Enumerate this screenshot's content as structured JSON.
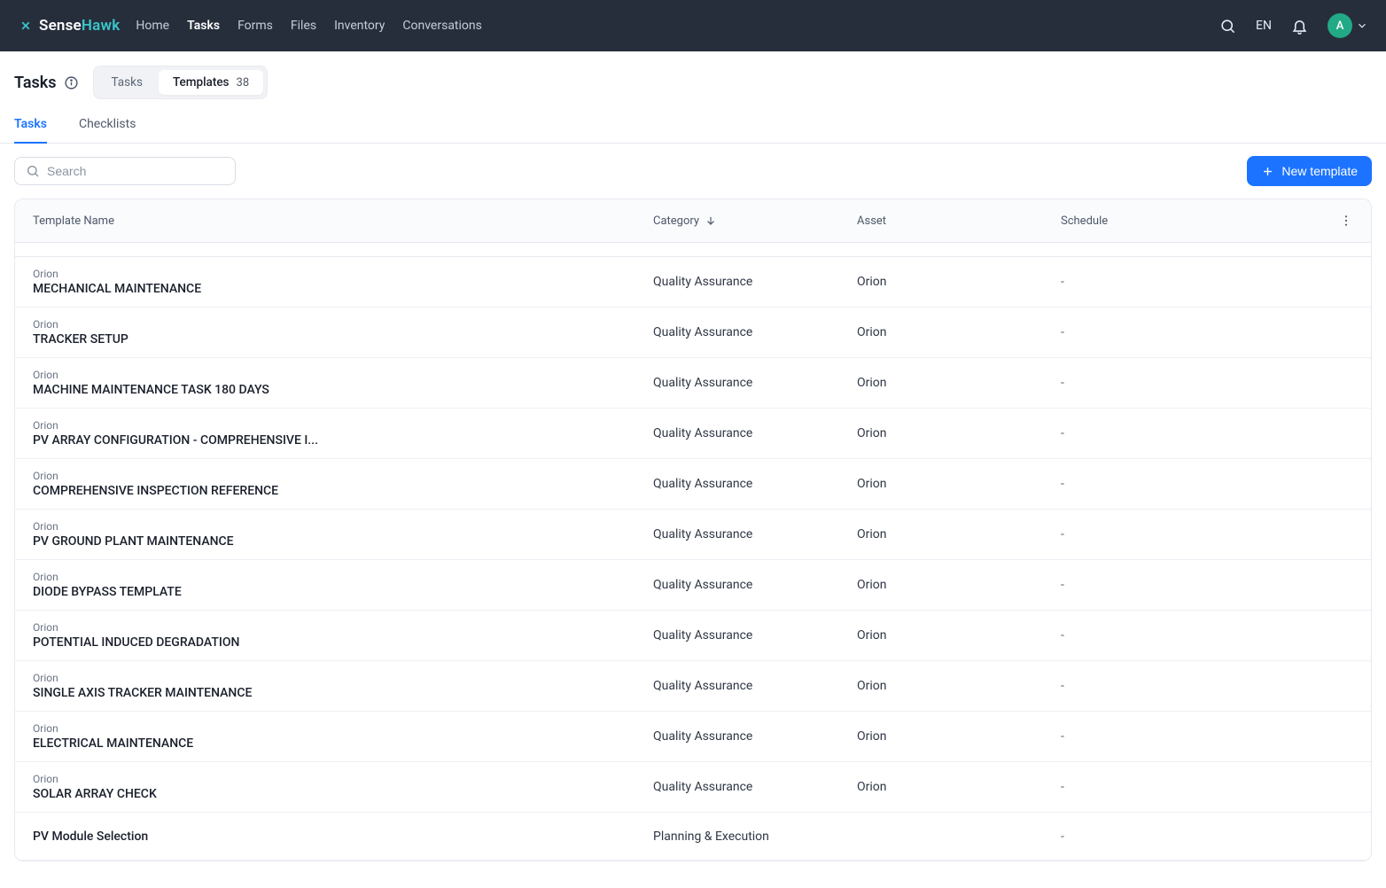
{
  "header": {
    "logo_sense": "Sense",
    "logo_hawk": "Hawk",
    "nav": [
      "Home",
      "Tasks",
      "Forms",
      "Files",
      "Inventory",
      "Conversations"
    ],
    "active_nav": "Tasks",
    "lang": "EN",
    "avatar_initial": "A"
  },
  "page": {
    "title": "Tasks",
    "segments": {
      "tasks": "Tasks",
      "templates_label": "Templates",
      "templates_count": "38"
    },
    "subtabs": {
      "tasks": "Tasks",
      "checklists": "Checklists"
    }
  },
  "toolbar": {
    "search_placeholder": "Search",
    "new_template_label": "New template"
  },
  "table": {
    "headers": {
      "name": "Template Name",
      "category": "Category",
      "asset": "Asset",
      "schedule": "Schedule"
    },
    "rows": [
      {
        "group": "Orion",
        "name": "MECHANICAL MAINTENANCE",
        "category": "Quality Assurance",
        "asset": "Orion",
        "schedule": "-"
      },
      {
        "group": "Orion",
        "name": "TRACKER SETUP",
        "category": "Quality Assurance",
        "asset": "Orion",
        "schedule": "-"
      },
      {
        "group": "Orion",
        "name": "MACHINE MAINTENANCE TASK 180 DAYS",
        "category": "Quality Assurance",
        "asset": "Orion",
        "schedule": "-"
      },
      {
        "group": "Orion",
        "name": "PV ARRAY CONFIGURATION - COMPREHENSIVE I...",
        "category": "Quality Assurance",
        "asset": "Orion",
        "schedule": "-"
      },
      {
        "group": "Orion",
        "name": "COMPREHENSIVE INSPECTION REFERENCE",
        "category": "Quality Assurance",
        "asset": "Orion",
        "schedule": "-"
      },
      {
        "group": "Orion",
        "name": "PV GROUND PLANT MAINTENANCE",
        "category": "Quality Assurance",
        "asset": "Orion",
        "schedule": "-"
      },
      {
        "group": "Orion",
        "name": "DIODE BYPASS TEMPLATE",
        "category": "Quality Assurance",
        "asset": "Orion",
        "schedule": "-"
      },
      {
        "group": "Orion",
        "name": "POTENTIAL INDUCED DEGRADATION",
        "category": "Quality Assurance",
        "asset": "Orion",
        "schedule": "-"
      },
      {
        "group": "Orion",
        "name": "SINGLE AXIS TRACKER MAINTENANCE",
        "category": "Quality Assurance",
        "asset": "Orion",
        "schedule": "-"
      },
      {
        "group": "Orion",
        "name": "ELECTRICAL MAINTENANCE",
        "category": "Quality Assurance",
        "asset": "Orion",
        "schedule": "-"
      },
      {
        "group": "Orion",
        "name": "SOLAR ARRAY CHECK",
        "category": "Quality Assurance",
        "asset": "Orion",
        "schedule": "-"
      },
      {
        "group": "",
        "name": "PV Module Selection",
        "category": "Planning & Execution",
        "asset": "",
        "schedule": "-"
      }
    ]
  }
}
